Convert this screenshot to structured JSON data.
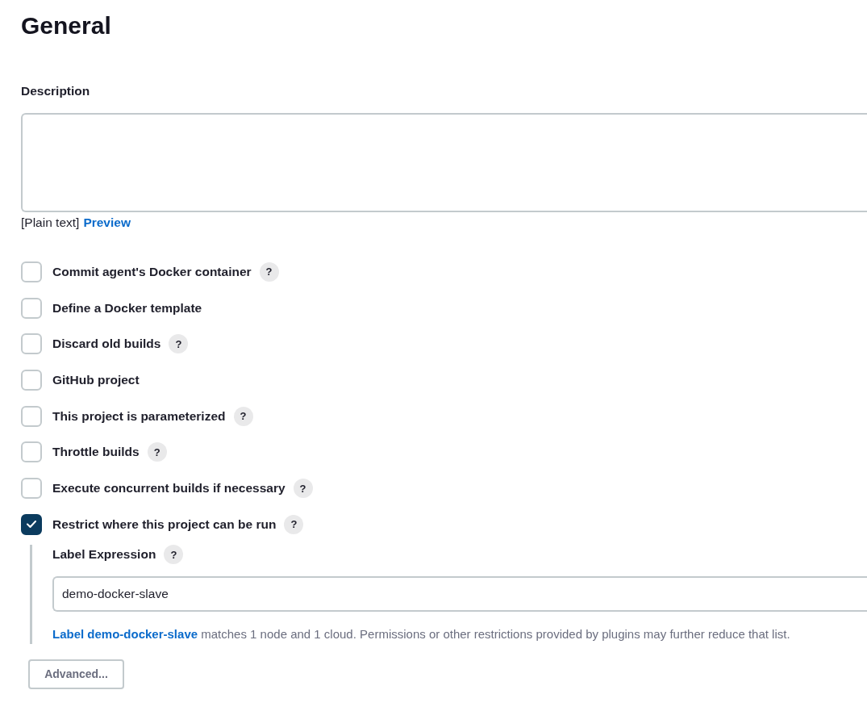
{
  "heading": "General",
  "description": {
    "label": "Description",
    "format_note": "[Plain text]",
    "preview_link": "Preview"
  },
  "options": [
    {
      "label": "Commit agent's Docker container",
      "checked": false,
      "help": "?"
    },
    {
      "label": "Define a Docker template",
      "checked": false
    },
    {
      "label": "Discard old builds",
      "checked": false,
      "help": "?"
    },
    {
      "label": "GitHub project",
      "checked": false
    },
    {
      "label": "This project is parameterized",
      "checked": false,
      "help": "?"
    },
    {
      "label": "Throttle builds",
      "checked": false,
      "help": "?"
    },
    {
      "label": "Execute concurrent builds if necessary",
      "checked": false,
      "help": "?"
    },
    {
      "label": "Restrict where this project can be run",
      "checked": true,
      "help": "?",
      "nested": {
        "label": "Label Expression",
        "help": "?",
        "value": "demo-docker-slave",
        "match_link": "Label demo-docker-slave",
        "match_text": "matches 1 node and 1 cloud. Permissions or other restrictions provided by plugins may further reduce that list."
      }
    }
  ],
  "advanced_button": "Advanced..."
}
